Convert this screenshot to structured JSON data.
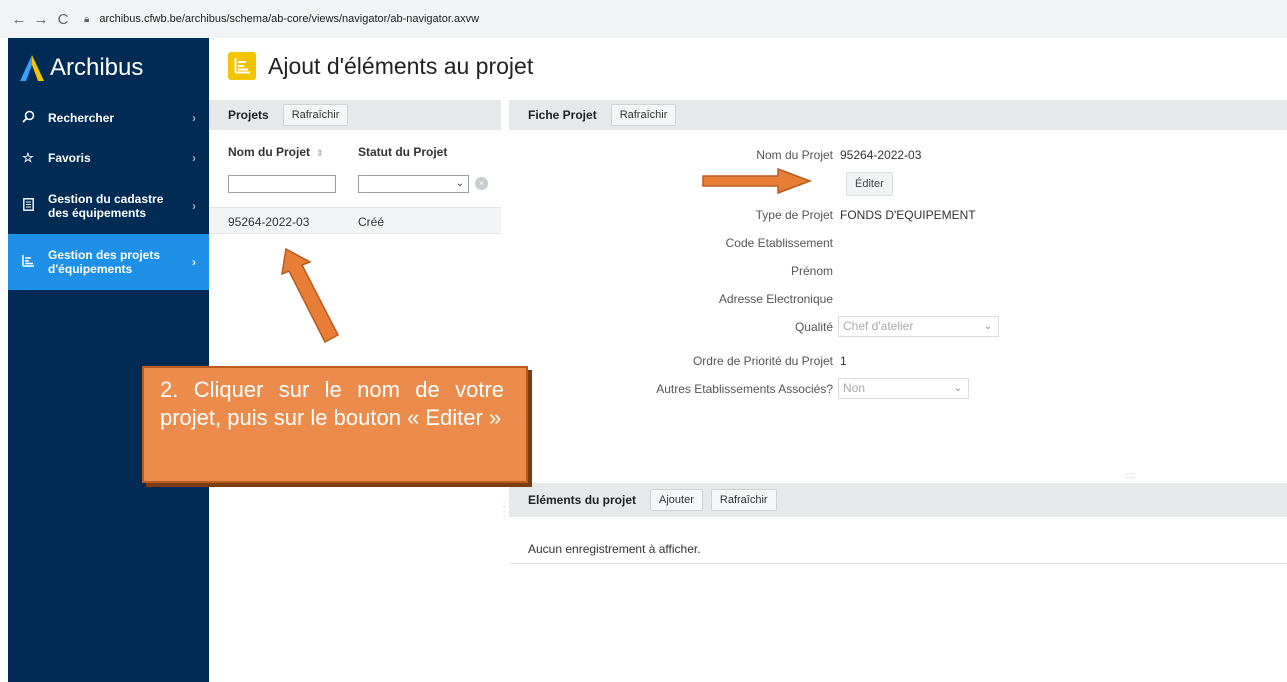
{
  "browser": {
    "back": "←",
    "forward": "→",
    "reload": "C",
    "url": "archibus.cfwb.be/archibus/schema/ab-core/views/navigator/ab-navigator.axvw"
  },
  "sidebar": {
    "brand": "Archibus",
    "items": [
      {
        "label": "Rechercher",
        "icon": "search-icon"
      },
      {
        "label": "Favoris",
        "icon": "star-icon"
      },
      {
        "label": "Gestion du cadastre des équipements",
        "icon": "book-icon"
      },
      {
        "label": "Gestion des projets d'équipements",
        "icon": "chart-icon"
      }
    ],
    "active_color": "#1e90e8",
    "bg_color": "#002b55"
  },
  "page": {
    "title": "Ajout d'éléments au projet"
  },
  "projets_panel": {
    "title": "Projets",
    "refresh": "Rafraîchir",
    "col_name": "Nom du Projet",
    "col_status": "Statut du Projet",
    "rows": [
      {
        "name": "95264-2022-03",
        "status": "Créé"
      }
    ]
  },
  "fiche_panel": {
    "title": "Fiche Projet",
    "refresh": "Rafraîchir",
    "edit": "Éditer",
    "fields": {
      "nom_label": "Nom du Projet",
      "nom_value": "95264-2022-03",
      "type_label": "Type de Projet",
      "type_value": "FONDS D'EQUIPEMENT",
      "code_label": "Code Etablissement",
      "prenom_label": "Prénom",
      "adresse_label": "Adresse Electronique",
      "qualite_label": "Qualité",
      "qualite_value": "Chef d'atelier",
      "ordre_label": "Ordre de Priorité du Projet",
      "ordre_value": "1",
      "autres_label": "Autres Etablissements Associés?",
      "autres_value": "Non"
    }
  },
  "elements_panel": {
    "title": "Eléments du projet",
    "add": "Ajouter",
    "refresh": "Rafraîchir",
    "empty": "Aucun enregistrement à afficher."
  },
  "callout": {
    "text": "2. Cliquer sur le nom de votre projet, puis sur le bouton « Editer »"
  },
  "colors": {
    "arrow": "#e87d35",
    "title_icon": "#f5c400"
  }
}
